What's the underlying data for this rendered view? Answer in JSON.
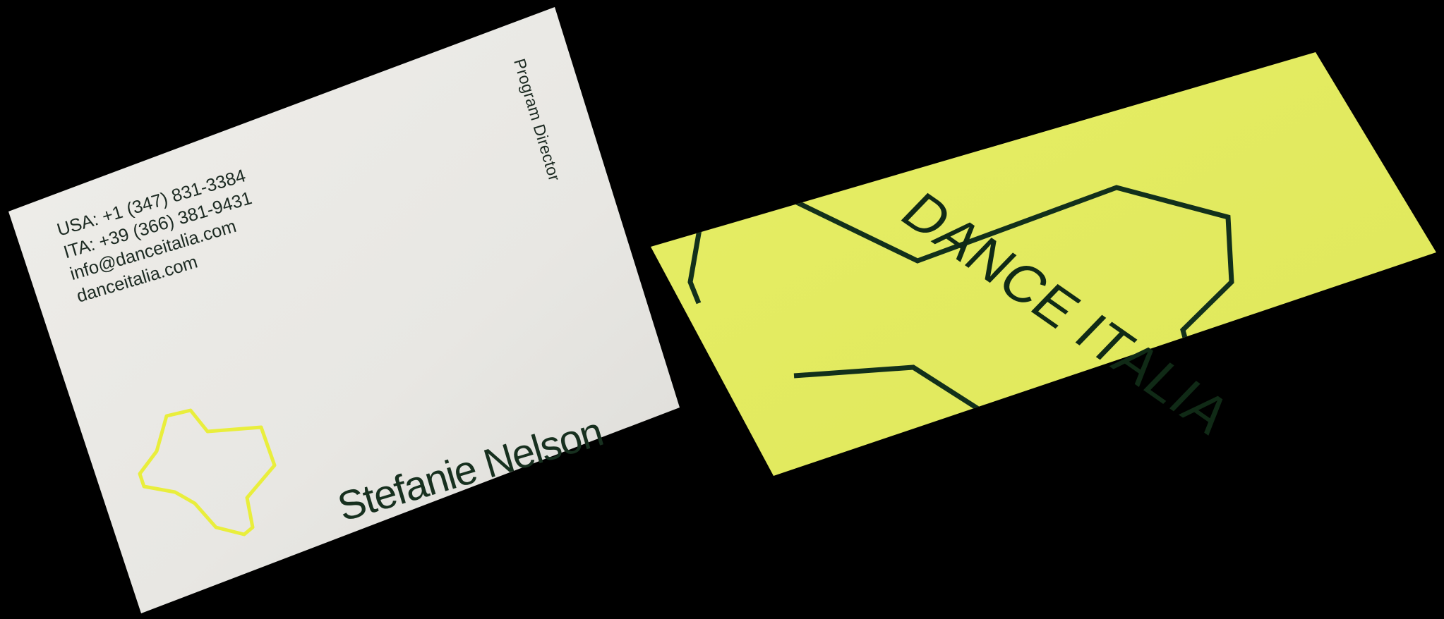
{
  "business_card_front": {
    "contact_lines": [
      "USA: +1 (347) 831-3384",
      "ITA: +39 (366) 381-9431",
      "info@danceitalia.com",
      "danceitalia.com"
    ],
    "role": "Program Director",
    "name": "Stefanie Nelson",
    "logo_icon": "cross-shape-logo-icon"
  },
  "business_card_back": {
    "brand": "DANCE ITALIA"
  },
  "colors": {
    "background": "#000000",
    "card_white": "#ecebe7",
    "card_yellow": "#e8ef5f",
    "ink_dark_green": "#15301f",
    "logo_yellow": "#e9ee3c"
  }
}
